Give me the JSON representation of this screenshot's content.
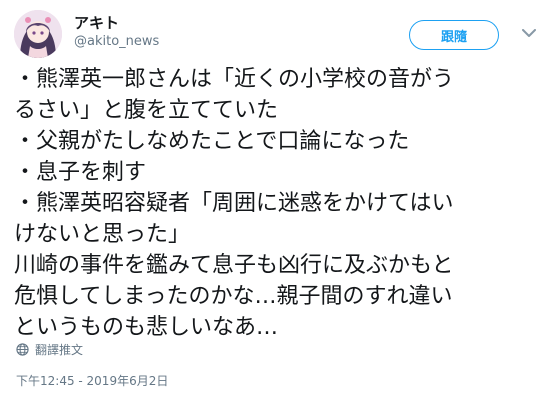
{
  "author": {
    "display_name": "アキト",
    "handle": "@akito_news"
  },
  "actions": {
    "follow_label": "跟隨"
  },
  "tweet": {
    "lines": [
      "・熊澤英一郎さんは「近くの小学校の音がう",
      "るさい」と腹を立てていた",
      "・父親がたしなめたことで口論になった",
      "・息子を刺す",
      "・熊澤英昭容疑者「周囲に迷惑をかけてはい",
      "けないと思った」",
      "川崎の事件を鑑みて息子も凶行に及ぶかもと",
      "危惧してしまったのかな…親子間のすれ違い",
      "というものも悲しいなあ…"
    ]
  },
  "translate": {
    "label": "翻譯推文",
    "icon": "globe-icon"
  },
  "timestamp": "下午12:45 - 2019年6月2日",
  "colors": {
    "accent": "#1da1f2",
    "text": "#14171a",
    "muted": "#657786"
  }
}
